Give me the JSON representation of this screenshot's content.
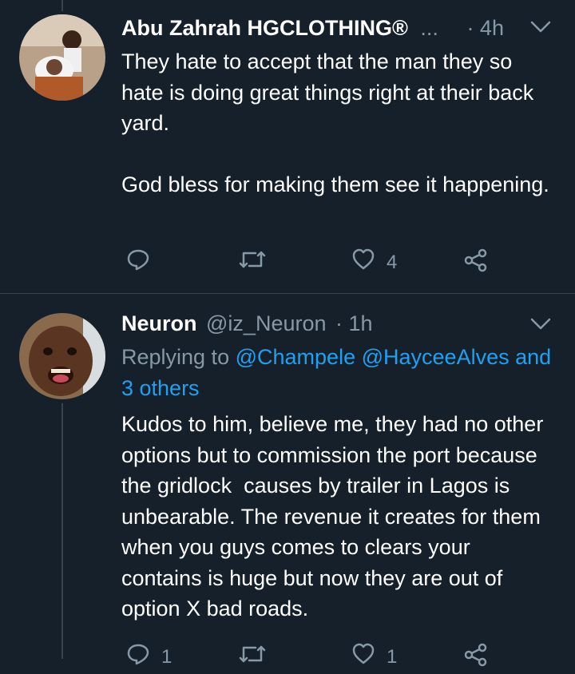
{
  "tweets": [
    {
      "author_name": "Abu Zahrah HGCLOTHING®",
      "ellipsis": "...",
      "time": "· 4h",
      "body": "They hate to accept that the man they so hate is doing great things right at their back yard.\n\nGod bless for making them see it happening.",
      "actions": {
        "reply_count": "",
        "retweet_count": "",
        "like_count": "4"
      }
    },
    {
      "author_name": "Neuron",
      "handle": "@iz_Neuron",
      "time": "· 1h",
      "replying_prefix": "Replying to",
      "replying_users": [
        "@Champele",
        "@HayceeAlves"
      ],
      "replying_others": "and 3 others",
      "body": "Kudos to him, believe me, they had no other options but to commission the port because the gridlock  causes by trailer in Lagos is unbearable. The revenue it creates for them when you guys comes to clears your contains is huge but now they are out of option X bad roads.",
      "actions": {
        "reply_count": "1",
        "retweet_count": "",
        "like_count": "1"
      }
    }
  ],
  "colors": {
    "background": "#15202b",
    "muted": "#8899a6",
    "link": "#1da1f2",
    "divider": "#38444d"
  }
}
